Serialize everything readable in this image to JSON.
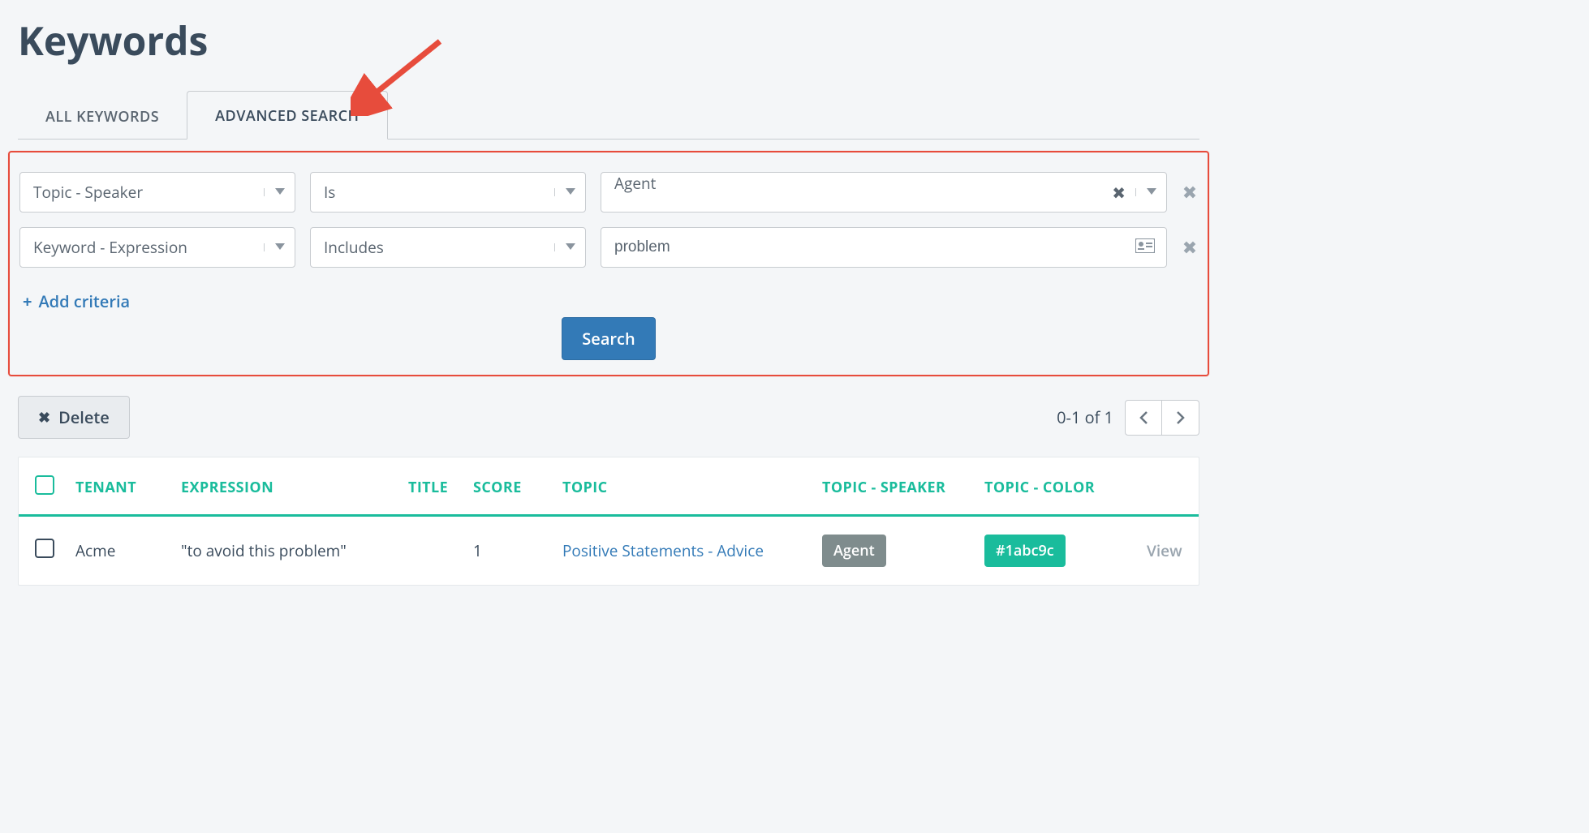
{
  "page": {
    "title": "Keywords"
  },
  "tabs": {
    "all": {
      "label": "ALL KEYWORDS"
    },
    "advanced": {
      "label": "ADVANCED SEARCH"
    }
  },
  "criteria": {
    "row0": {
      "field": "Topic - Speaker",
      "op": "Is",
      "value": "Agent"
    },
    "row1": {
      "field": "Keyword - Expression",
      "op": "Includes",
      "value": "problem"
    }
  },
  "addCriteria": {
    "label": "Add criteria"
  },
  "searchBtn": {
    "label": "Search"
  },
  "deleteBtn": {
    "label": "Delete"
  },
  "pager": {
    "count": "0-1 of 1"
  },
  "columns": {
    "tenant": "TENANT",
    "expression": "EXPRESSION",
    "title": "TITLE",
    "score": "SCORE",
    "topic": "TOPIC",
    "speaker": "TOPIC - SPEAKER",
    "color": "TOPIC - COLOR"
  },
  "rows": {
    "r0": {
      "tenant": "Acme",
      "expression": "\"to avoid this problem\"",
      "title": "",
      "score": "1",
      "topic": "Positive Statements - Advice",
      "speaker": "Agent",
      "color": "#1abc9c",
      "view": "View"
    }
  }
}
